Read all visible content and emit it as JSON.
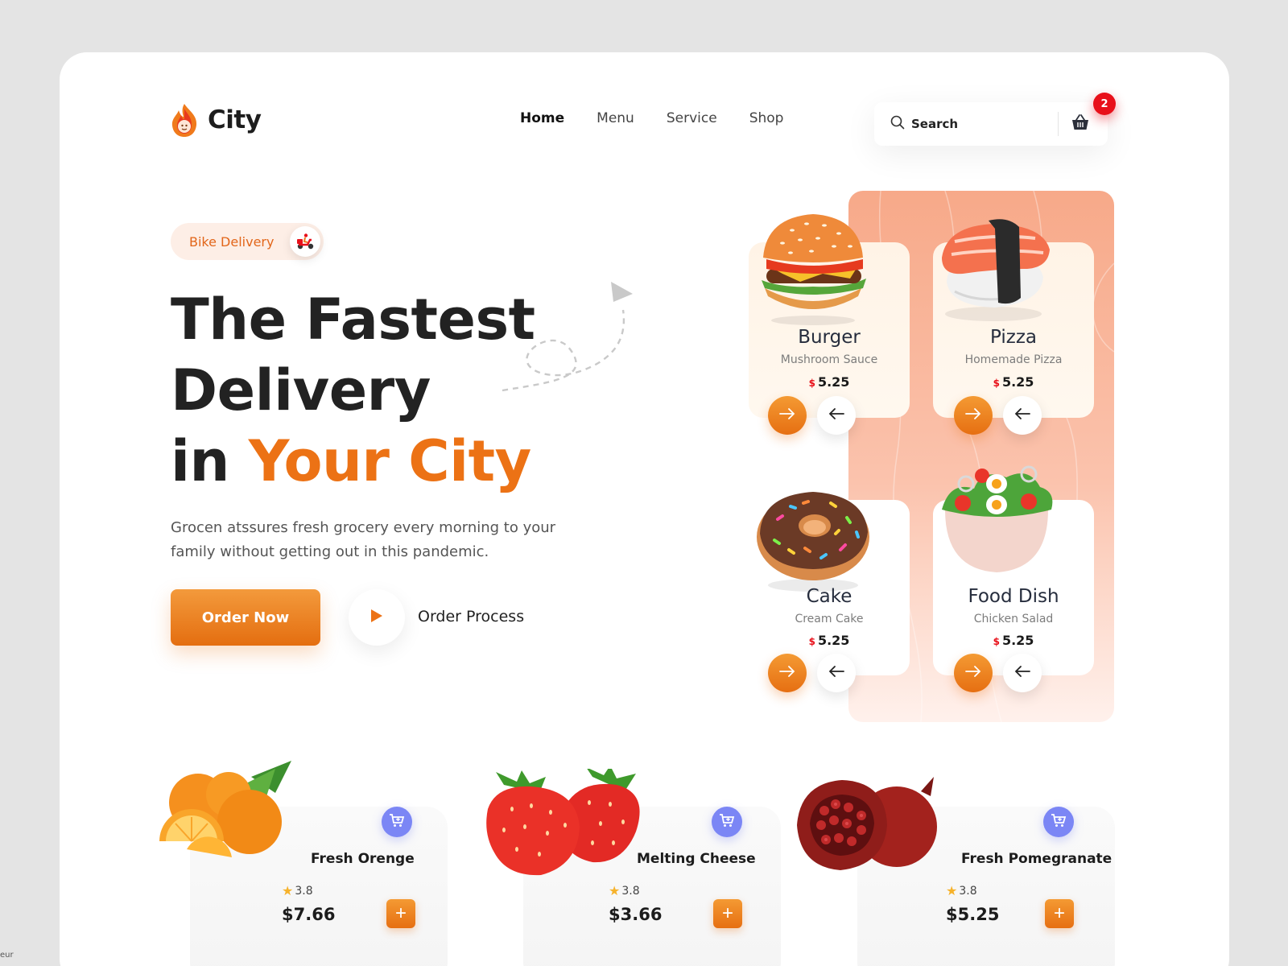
{
  "brand": {
    "name": "City"
  },
  "nav": {
    "items": [
      "Home",
      "Menu",
      "Service",
      "Shop"
    ],
    "active": "Home"
  },
  "search": {
    "placeholder": "Search"
  },
  "cart": {
    "count": "2"
  },
  "hero": {
    "pill": "Bike Delivery",
    "title_line1": "The Fastest",
    "title_line2": "Delivery",
    "title_line3_prefix": "in ",
    "title_line3_accent": "Your City",
    "description": "Grocen atssures fresh grocery every morning to your family without getting out in this pandemic.",
    "order_button": "Order Now",
    "process_label": "Order Process"
  },
  "foods": [
    {
      "name": "Burger",
      "sub": "Mushroom Sauce",
      "currency": "$",
      "price": "5.25"
    },
    {
      "name": "Pizza",
      "sub": "Homemade Pizza",
      "currency": "$",
      "price": "5.25"
    },
    {
      "name": "Cake",
      "sub": "Cream Cake",
      "currency": "$",
      "price": "5.25"
    },
    {
      "name": "Food Dish",
      "sub": "Chicken Salad",
      "currency": "$",
      "price": "5.25"
    }
  ],
  "products": [
    {
      "name": "Fresh Orenge",
      "rating": "3.8",
      "price": "$7.66"
    },
    {
      "name": "Melting Cheese",
      "rating": "3.8",
      "price": "$3.66"
    },
    {
      "name": "Fresh Pomegranate",
      "rating": "3.8",
      "price": "$5.25"
    }
  ],
  "corner_note": "eur",
  "colors": {
    "accent": "#ec7215",
    "badge": "#e8101a",
    "cart_chip": "#7b86f5",
    "panel": "#f7a989"
  },
  "icons": [
    "flame-logo-icon",
    "search-icon",
    "basket-icon",
    "scooter-icon",
    "play-icon",
    "arrow-right-icon",
    "arrow-left-icon",
    "cart-plus-icon",
    "star-icon",
    "plus-icon"
  ]
}
